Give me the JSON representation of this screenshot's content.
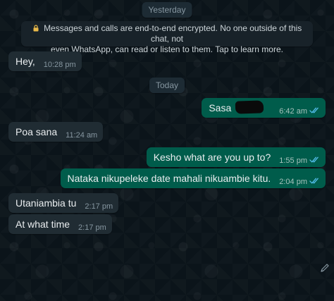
{
  "date_separators": {
    "yesterday": "Yesterday",
    "today": "Today"
  },
  "encryption_notice": {
    "line1": "Messages and calls are end-to-end encrypted. No one outside of this chat, not",
    "line2": "even WhatsApp, can read or listen to them. Tap to learn more.",
    "icon": "lock-icon"
  },
  "messages": [
    {
      "direction": "incoming",
      "text": "Hey,",
      "time": "10:28 pm"
    },
    {
      "direction": "outgoing",
      "text": "Sasa",
      "time": "6:42 am",
      "status": "read",
      "redacted": true
    },
    {
      "direction": "incoming",
      "text": "Poa sana",
      "time": "11:24 am"
    },
    {
      "direction": "outgoing",
      "text": "Kesho what are you up to?",
      "time": "1:55 pm",
      "status": "read"
    },
    {
      "direction": "outgoing",
      "text": "Nataka nikupeleke date mahali nikuambie kitu.",
      "time": "2:04 pm",
      "status": "read"
    },
    {
      "direction": "incoming",
      "text": "Utaniambia tu",
      "time": "2:17 pm"
    },
    {
      "direction": "incoming",
      "text": "At what time",
      "time": "2:17 pm"
    }
  ],
  "colors": {
    "background": "#0b141a",
    "incoming_bubble": "#202c33",
    "outgoing_bubble": "#005c4b",
    "read_tick": "#53bdeb"
  },
  "icons": {
    "read_receipt": "double-check-icon",
    "edit": "pencil-icon"
  }
}
